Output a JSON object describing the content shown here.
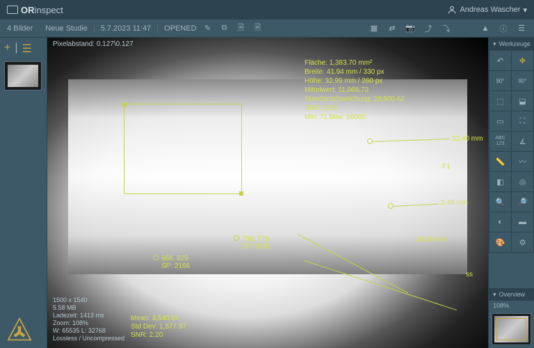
{
  "app": {
    "name_prefix": "OR",
    "name_suffix": "inspect"
  },
  "user": {
    "name": "Andreas Wascher"
  },
  "subbar": {
    "image_count": "4 Bilder",
    "study": "Neue Studie",
    "date": "5.7.2023 11:47",
    "status": "OPENED"
  },
  "pixel_info": "Pixelabstand: 0.127\\0.127",
  "roi_stats": {
    "area": "Fläche: 1,383.70 mm²",
    "width": "Breite: 41.94 mm / 330 px",
    "height": "Höhe: 32.99 mm / 260 px",
    "mean": "Mittelwert: 11,068.73",
    "stddev": "Standardabweichung: 20,900.62",
    "snr": "SNR: 0.53",
    "minmax": "Min: 71  Max: 56000"
  },
  "measurements": {
    "m1": "32.40 mm",
    "f1": "F1",
    "m2": "2.46 mm",
    "m3": "34.60 mm",
    "m4": "ss"
  },
  "points": {
    "p1": {
      "coord": "796, 776",
      "sp": "SP: 3831"
    },
    "p2": {
      "coord": "666, 829",
      "sp": "SP: 2166"
    }
  },
  "bottom": {
    "dims": "1500 x 1540",
    "size": "5.58 MB",
    "load": "Ladezeit: 1413 ms",
    "zoom": "Zoom: 108%",
    "wl": "W: 65535 L: 32768",
    "comp": "Lossless / Uncompressed"
  },
  "bottom_stats": {
    "mean": "Mean: 3,540.54",
    "stddev": "Std Dev: 1,577.97",
    "snr": "SNR: 2.20"
  },
  "panels": {
    "tools": "Werkzeuge",
    "overview": "Overview",
    "zoom": "108%"
  },
  "tool_labels": {
    "abc": "ABC",
    "123": "123",
    "deg1": "90°",
    "deg2": "90°"
  }
}
